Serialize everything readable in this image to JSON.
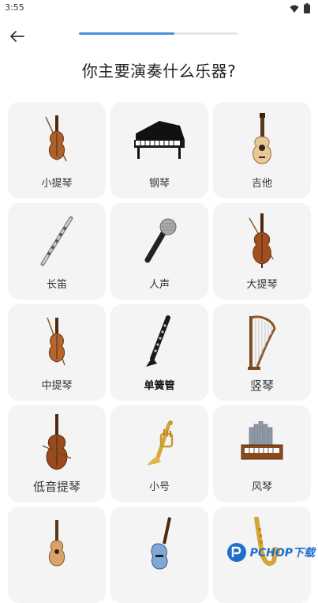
{
  "status": {
    "time": "3:55"
  },
  "header": {
    "progress": 0.6
  },
  "title": "你主要演奏什么乐器?",
  "instruments": [
    {
      "label": "小提琴",
      "icon": "violin-icon"
    },
    {
      "label": "钢琴",
      "icon": "grand-piano-icon"
    },
    {
      "label": "吉他",
      "icon": "acoustic-guitar-icon"
    },
    {
      "label": "长笛",
      "icon": "flute-icon"
    },
    {
      "label": "人声",
      "icon": "microphone-icon"
    },
    {
      "label": "大提琴",
      "icon": "cello-icon"
    },
    {
      "label": "中提琴",
      "icon": "viola-icon"
    },
    {
      "label": "单簧管",
      "icon": "clarinet-icon"
    },
    {
      "label": "竖琴",
      "icon": "harp-icon"
    },
    {
      "label": "低音提琴",
      "icon": "double-bass-icon"
    },
    {
      "label": "小号",
      "icon": "trumpet-icon"
    },
    {
      "label": "风琴",
      "icon": "organ-icon"
    },
    {
      "label": "",
      "icon": "ukulele-icon"
    },
    {
      "label": "",
      "icon": "electric-guitar-icon"
    },
    {
      "label": "",
      "icon": "saxophone-icon"
    }
  ],
  "watermark": {
    "text": "PCHOP下载"
  },
  "colors": {
    "accent": "#4a90d9",
    "card_bg": "#f5f4f4",
    "wood": "#a0522d"
  }
}
